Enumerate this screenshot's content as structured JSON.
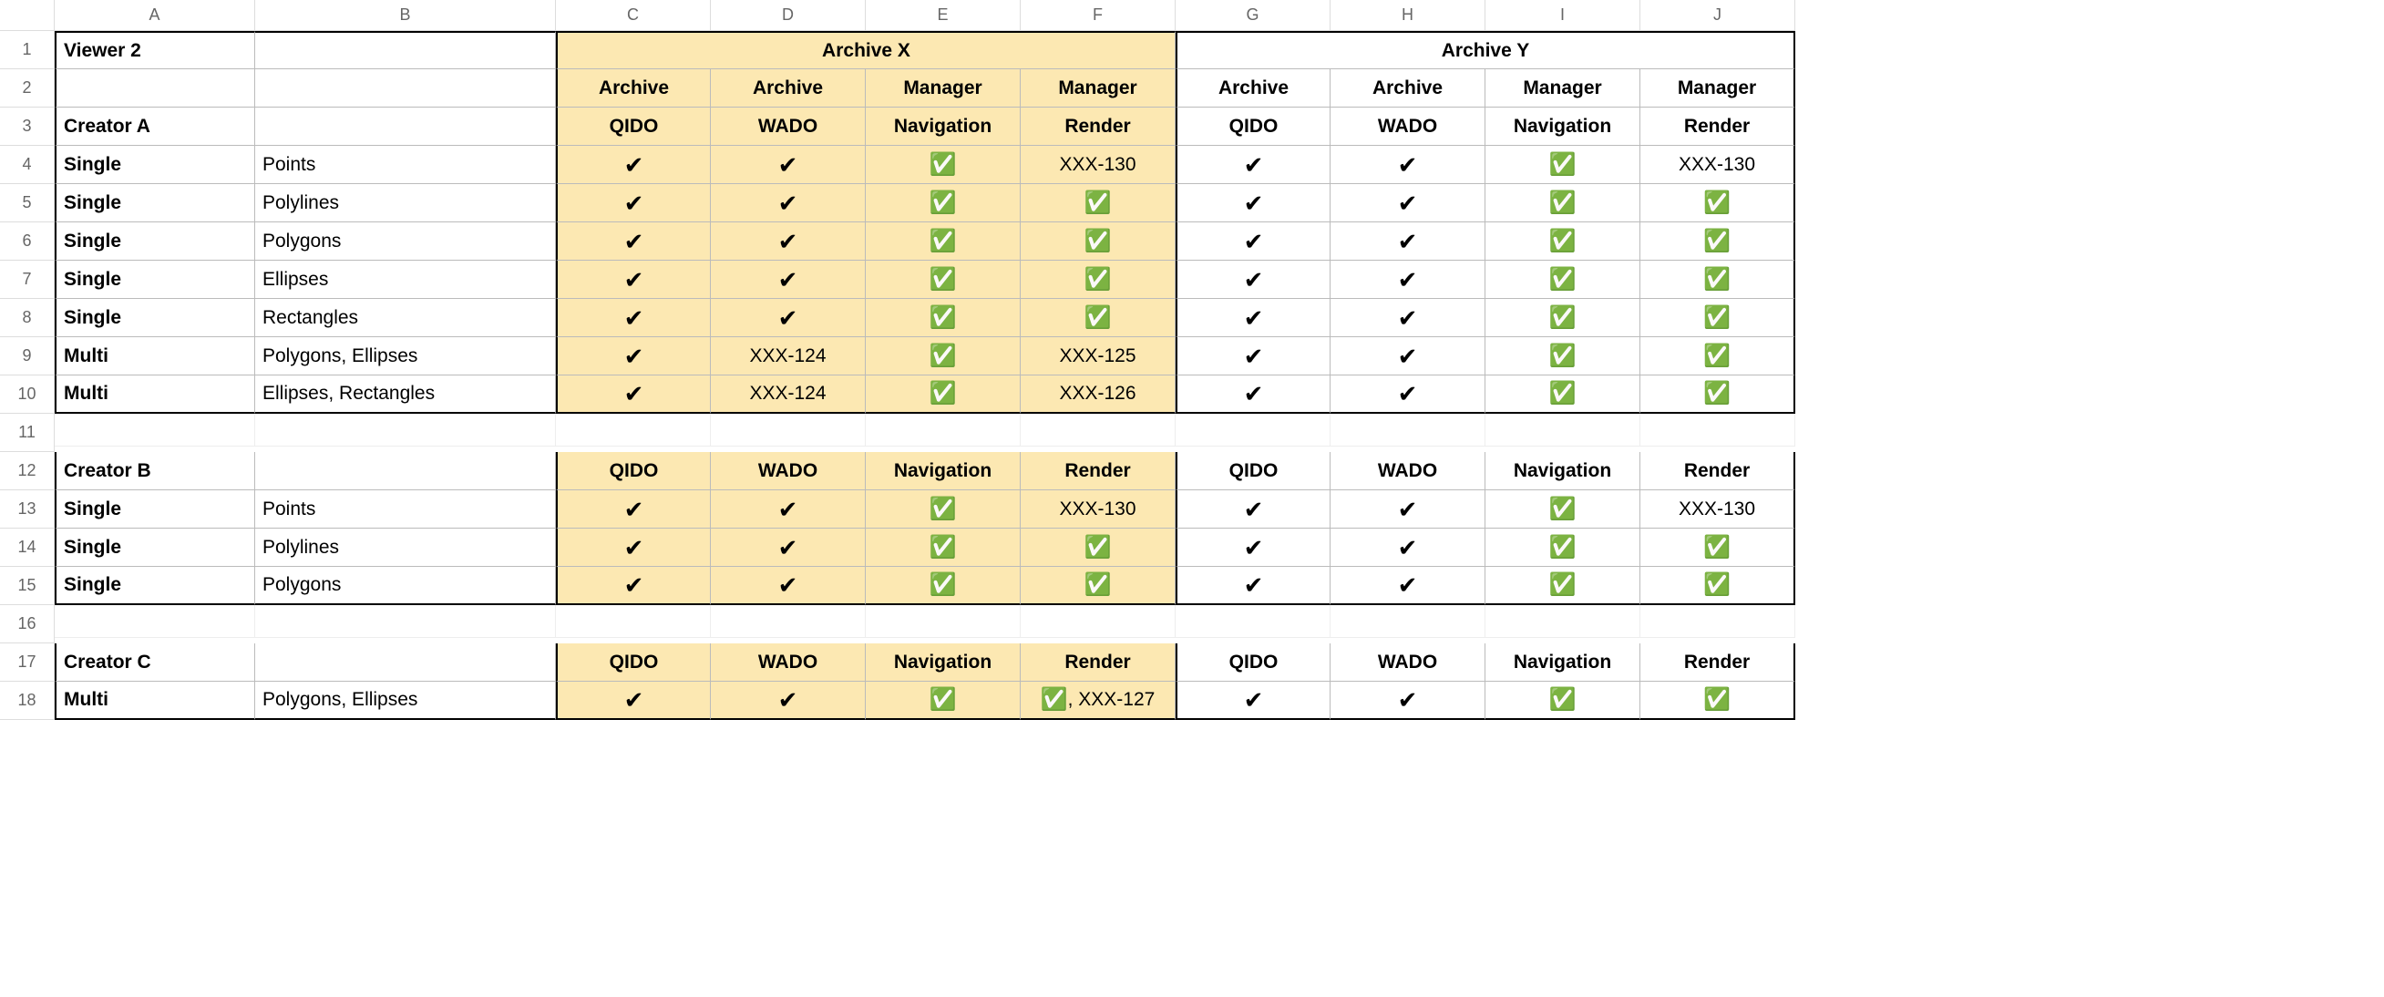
{
  "sym": {
    "check": "✔",
    "green": "✅"
  },
  "colLetters": [
    "A",
    "B",
    "C",
    "D",
    "E",
    "F",
    "G",
    "H",
    "I",
    "J"
  ],
  "headers": {
    "row1": {
      "A": "Viewer 2",
      "archiveX": "Archive X",
      "archiveY": "Archive Y"
    },
    "row2": {
      "C": "Archive",
      "D": "Archive",
      "E": "Manager",
      "F": "Manager",
      "G": "Archive",
      "H": "Archive",
      "I": "Manager",
      "J": "Manager"
    }
  },
  "subheadLabels": {
    "C": "QIDO",
    "D": "WADO",
    "E": "Navigation",
    "F": "Render",
    "G": "QIDO",
    "H": "WADO",
    "I": "Navigation",
    "J": "Render"
  },
  "sections": [
    {
      "creator": "Creator A",
      "rows": [
        {
          "a": "Single",
          "b": "Points",
          "c": "chk",
          "d": "chk",
          "e": "grn",
          "f": "XXX-130",
          "g": "chk",
          "h": "chk",
          "i": "grn",
          "j": "XXX-130"
        },
        {
          "a": "Single",
          "b": "Polylines",
          "c": "chk",
          "d": "chk",
          "e": "grn",
          "f": "grn",
          "g": "chk",
          "h": "chk",
          "i": "grn",
          "j": "grn"
        },
        {
          "a": "Single",
          "b": "Polygons",
          "c": "chk",
          "d": "chk",
          "e": "grn",
          "f": "grn",
          "g": "chk",
          "h": "chk",
          "i": "grn",
          "j": "grn"
        },
        {
          "a": "Single",
          "b": "Ellipses",
          "c": "chk",
          "d": "chk",
          "e": "grn",
          "f": "grn",
          "g": "chk",
          "h": "chk",
          "i": "grn",
          "j": "grn"
        },
        {
          "a": "Single",
          "b": "Rectangles",
          "c": "chk",
          "d": "chk",
          "e": "grn",
          "f": "grn",
          "g": "chk",
          "h": "chk",
          "i": "grn",
          "j": "grn"
        },
        {
          "a": "Multi",
          "b": "Polygons, Ellipses",
          "c": "chk",
          "d": "XXX-124",
          "e": "grn",
          "f": "XXX-125",
          "g": "chk",
          "h": "chk",
          "i": "grn",
          "j": "grn"
        },
        {
          "a": "Multi",
          "b": "Ellipses, Rectangles",
          "c": "chk",
          "d": "XXX-124",
          "e": "grn",
          "f": "XXX-126",
          "g": "chk",
          "h": "chk",
          "i": "grn",
          "j": "grn"
        }
      ]
    },
    {
      "creator": "Creator B",
      "rows": [
        {
          "a": "Single",
          "b": "Points",
          "c": "chk",
          "d": "chk",
          "e": "grn",
          "f": "XXX-130",
          "g": "chk",
          "h": "chk",
          "i": "grn",
          "j": "XXX-130"
        },
        {
          "a": "Single",
          "b": "Polylines",
          "c": "chk",
          "d": "chk",
          "e": "grn",
          "f": "grn",
          "g": "chk",
          "h": "chk",
          "i": "grn",
          "j": "grn"
        },
        {
          "a": "Single",
          "b": "Polygons",
          "c": "chk",
          "d": "chk",
          "e": "grn",
          "f": "grn",
          "g": "chk",
          "h": "chk",
          "i": "grn",
          "j": "grn"
        }
      ]
    },
    {
      "creator": "Creator C",
      "rows": [
        {
          "a": "Multi",
          "b": "Polygons, Ellipses",
          "c": "chk",
          "d": "chk",
          "e": "grn",
          "f": "grn+XXX-127",
          "g": "chk",
          "h": "chk",
          "i": "grn",
          "j": "grn"
        }
      ]
    }
  ]
}
